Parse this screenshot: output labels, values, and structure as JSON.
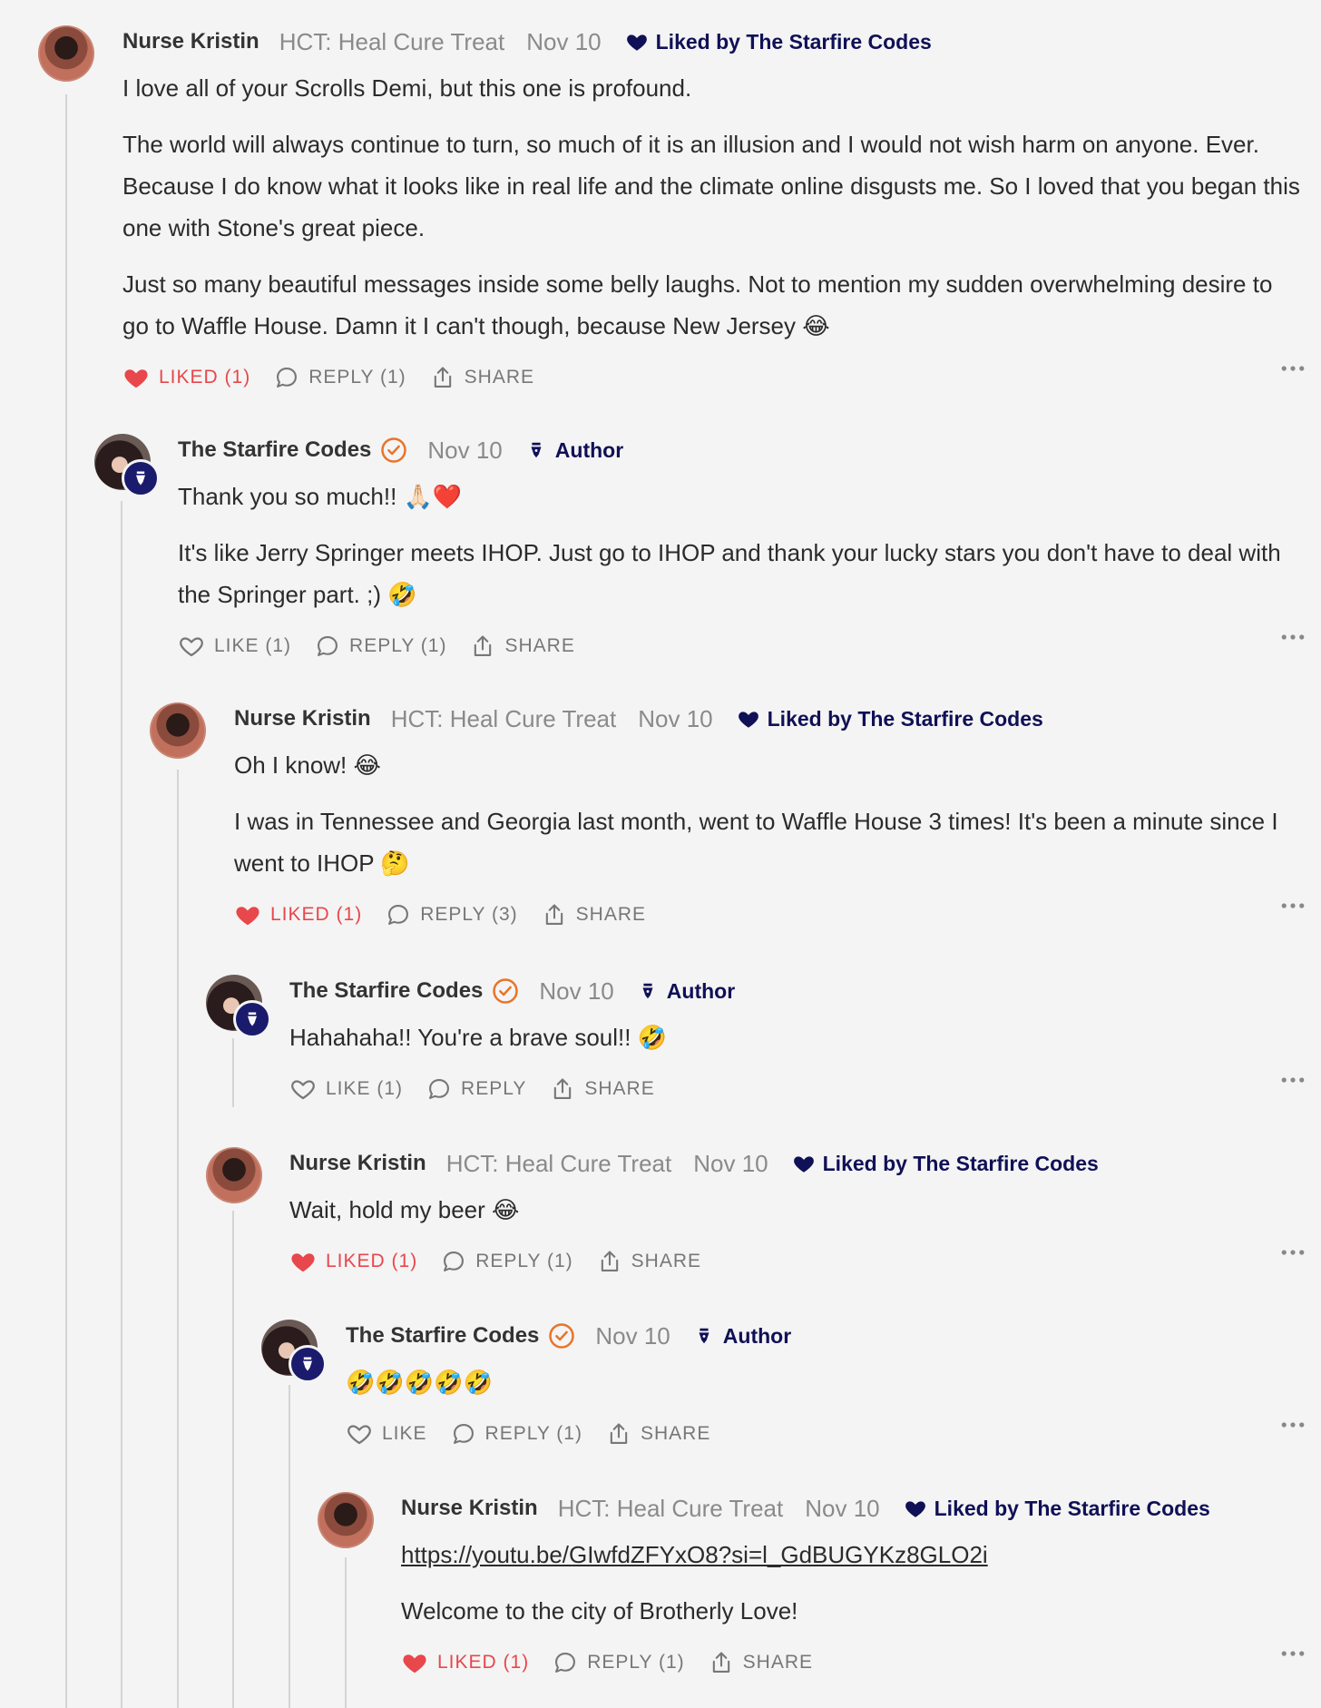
{
  "colors": {
    "background": "#f4f4f4",
    "liked_red": "#e8474b",
    "navy": "#101057",
    "verified_orange": "#e8742a",
    "muted": "#8a8a8a"
  },
  "comments": [
    {
      "author": "Nurse Kristin",
      "publication": "HCT: Heal Cure Treat",
      "date": "Nov 10",
      "liked_by": "Liked by The Starfire Codes",
      "paragraphs": [
        "I love all of your Scrolls Demi, but this one is profound.",
        "The world will always continue to turn, so much of it is an illusion and I would not wish harm on anyone. Ever. Because I do know what it looks like in real life and the climate online disgusts me. So I loved that you began this one with Stone's great piece.",
        "Just so many beautiful messages inside some belly laughs. Not to mention my sudden overwhelming desire to go to Waffle House. Damn it I can't though, because New Jersey 😂"
      ],
      "like_label": "LIKED (1)",
      "reply_label": "REPLY (1)",
      "share_label": "SHARE"
    },
    {
      "author": "The Starfire Codes",
      "date": "Nov 10",
      "badge": "Author",
      "paragraphs": [
        "Thank you so much!! 🙏🏻❤️",
        "It's like Jerry Springer meets IHOP. Just go to IHOP and thank your lucky stars you don't have to deal with the Springer part. ;) 🤣"
      ],
      "like_label": "LIKE (1)",
      "reply_label": "REPLY (1)",
      "share_label": "SHARE"
    },
    {
      "author": "Nurse Kristin",
      "publication": "HCT: Heal Cure Treat",
      "date": "Nov 10",
      "liked_by": "Liked by The Starfire Codes",
      "paragraphs": [
        "Oh I know! 😂",
        "I was in Tennessee and Georgia last month, went to Waffle House 3 times! It's been a minute since I went to IHOP 🤔"
      ],
      "like_label": "LIKED (1)",
      "reply_label": "REPLY (3)",
      "share_label": "SHARE"
    },
    {
      "author": "The Starfire Codes",
      "date": "Nov 10",
      "badge": "Author",
      "paragraphs": [
        "Hahahaha!! You're a brave soul!! 🤣"
      ],
      "like_label": "LIKE (1)",
      "reply_label": "REPLY",
      "share_label": "SHARE"
    },
    {
      "author": "Nurse Kristin",
      "publication": "HCT: Heal Cure Treat",
      "date": "Nov 10",
      "liked_by": "Liked by The Starfire Codes",
      "paragraphs": [
        "Wait, hold my beer 😂"
      ],
      "like_label": "LIKED (1)",
      "reply_label": "REPLY (1)",
      "share_label": "SHARE"
    },
    {
      "author": "The Starfire Codes",
      "date": "Nov 10",
      "badge": "Author",
      "paragraphs": [
        "🤣🤣🤣🤣🤣"
      ],
      "like_label": "LIKE",
      "reply_label": "REPLY (1)",
      "share_label": "SHARE"
    },
    {
      "author": "Nurse Kristin",
      "publication": "HCT: Heal Cure Treat",
      "date": "Nov 10",
      "liked_by": "Liked by The Starfire Codes",
      "link": "https://youtu.be/GIwfdZFYxO8?si=l_GdBUGYKz8GLO2i",
      "paragraphs": [
        "Welcome to the city of Brotherly Love!"
      ],
      "like_label": "LIKED (1)",
      "reply_label": "REPLY (1)",
      "share_label": "SHARE"
    }
  ]
}
